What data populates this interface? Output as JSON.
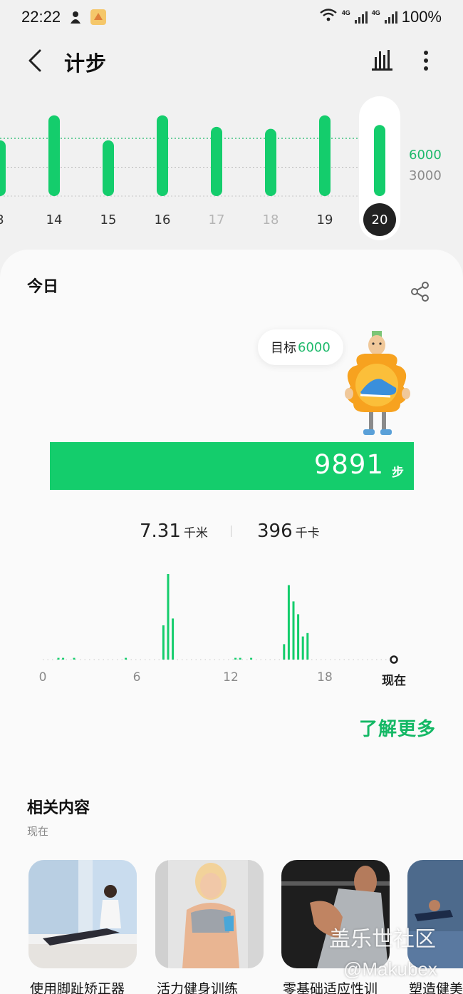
{
  "status_bar": {
    "time": "22:22",
    "net1": "4G",
    "net2": "4G",
    "battery": "100%"
  },
  "header": {
    "title": "计步"
  },
  "week_chart": {
    "goal_label": "6000",
    "mid_label": "3000",
    "days": [
      {
        "label": "3",
        "value": 5200,
        "muted": false,
        "selected": false
      },
      {
        "label": "14",
        "value": 7800,
        "muted": false,
        "selected": false
      },
      {
        "label": "15",
        "value": 5200,
        "muted": false,
        "selected": false
      },
      {
        "label": "16",
        "value": 7800,
        "muted": false,
        "selected": false
      },
      {
        "label": "17",
        "value": 6600,
        "muted": true,
        "selected": false
      },
      {
        "label": "18",
        "value": 6400,
        "muted": true,
        "selected": false
      },
      {
        "label": "19",
        "value": 7800,
        "muted": false,
        "selected": false
      },
      {
        "label": "20",
        "value": 6800,
        "muted": false,
        "selected": true
      }
    ]
  },
  "today": {
    "title": "今日",
    "goal_prefix": "目标",
    "goal_value": "6000",
    "steps": "9891",
    "steps_unit": "步",
    "distance": "7.31",
    "distance_unit": "千米",
    "calories": "396",
    "calories_unit": "千卡"
  },
  "chart_data": {
    "type": "bar",
    "x_ticks": [
      "0",
      "6",
      "12",
      "18",
      "现在"
    ],
    "hourly_relative": [
      {
        "hour": 1.0,
        "v": 0.02
      },
      {
        "hour": 1.3,
        "v": 0.02
      },
      {
        "hour": 2.0,
        "v": 0.02
      },
      {
        "hour": 5.3,
        "v": 0.02
      },
      {
        "hour": 7.7,
        "v": 0.4
      },
      {
        "hour": 8.0,
        "v": 1.0
      },
      {
        "hour": 8.3,
        "v": 0.48
      },
      {
        "hour": 12.3,
        "v": 0.02
      },
      {
        "hour": 12.6,
        "v": 0.02
      },
      {
        "hour": 13.3,
        "v": 0.02
      },
      {
        "hour": 15.4,
        "v": 0.18
      },
      {
        "hour": 15.7,
        "v": 0.87
      },
      {
        "hour": 16.0,
        "v": 0.68
      },
      {
        "hour": 16.3,
        "v": 0.53
      },
      {
        "hour": 16.6,
        "v": 0.27
      },
      {
        "hour": 16.9,
        "v": 0.31
      }
    ]
  },
  "links": {
    "learn_more": "了解更多"
  },
  "related": {
    "title": "相关内容",
    "subtitle": "现在",
    "items": [
      {
        "caption": "使用脚趾矫正器"
      },
      {
        "caption": "活力健身训练"
      },
      {
        "caption": "零基础适应性训"
      },
      {
        "caption": "塑造健美"
      }
    ]
  },
  "watermark": {
    "line1": "盖乐世社区",
    "line2": "@Makubex"
  },
  "colors": {
    "accent": "#14cd6c",
    "accent_text": "#1db96a",
    "link": "#14b865"
  }
}
